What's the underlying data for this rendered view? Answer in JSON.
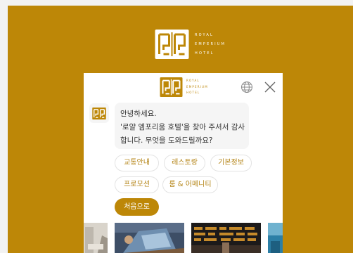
{
  "brand": {
    "lines": [
      "ROYAL",
      "EMPERIUM",
      "HOTEL"
    ]
  },
  "chat": {
    "greeting_lines": [
      "안녕하세요.",
      "'로얄 엠포리움 호텔'을 찾아 주셔서 감사",
      "합니다. 무엇을 도와드릴까요?"
    ],
    "quick_replies": [
      "교통안내",
      "레스토랑",
      "기본정보",
      "프로모션",
      "룸 & 어메니티"
    ],
    "home_button": "처음으로"
  },
  "icons": {
    "globe": "globe-icon",
    "close": "close-icon",
    "avatar": "hotel-logo-icon"
  },
  "colors": {
    "brand_gold": "#bd8707",
    "chip_text": "#b48416",
    "bubble_bg": "#f5f5f5"
  }
}
